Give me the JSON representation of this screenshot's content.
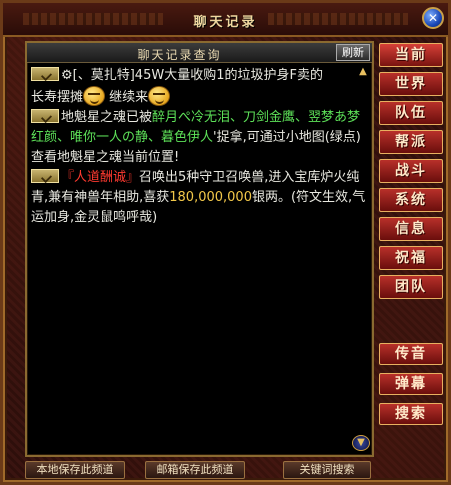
{
  "window": {
    "title": "聊天记录"
  },
  "panel": {
    "title": "聊天记录查询",
    "refresh_label": "刷新"
  },
  "chat": {
    "line1": {
      "prefix": "⚙[、莫扎特]45W大量收购1的垃圾护身F卖的",
      "cont": "长寿摆摊",
      "mid": "  继续来"
    },
    "line2": {
      "pre": "地魁星之魂已被",
      "names": "醉月ぺ冷无泪、刀剑金鹰、翌梦あ梦红颜、唯你一人の静、暮色伊人",
      "post": "'捉拿,可通过小地图(绿点)查看地魁星之魂当前位置!"
    },
    "line3": {
      "name": "『人道酬诚』",
      "pre": "召唤出5种守卫召唤兽,进入宝库炉火纯青,兼有神兽年相助,喜获",
      "amount": "180,000,000",
      "post": "银两。(符文生效,气运加身,金灵鼠鸣呼哉)"
    }
  },
  "tabs": [
    "当前",
    "世界",
    "队伍",
    "帮派",
    "战斗",
    "系统",
    "信息",
    "祝福",
    "团队"
  ],
  "tabs2": [
    "传音",
    "弹幕",
    "搜索"
  ],
  "bottom": {
    "save_local": "本地保存此频道",
    "save_mail": "邮箱保存此频道",
    "keyword_search": "关键词搜索"
  },
  "icons": {
    "close": "close-icon",
    "channel": "channel-speaker-icon",
    "emoji": "smiley-emoji-icon",
    "scroll": "scroll-down-icon"
  },
  "colors": {
    "highlight_green": "#5de058",
    "highlight_red": "#ff3a30",
    "highlight_gold": "#f2c84a",
    "tab_red": "#b8302a"
  }
}
